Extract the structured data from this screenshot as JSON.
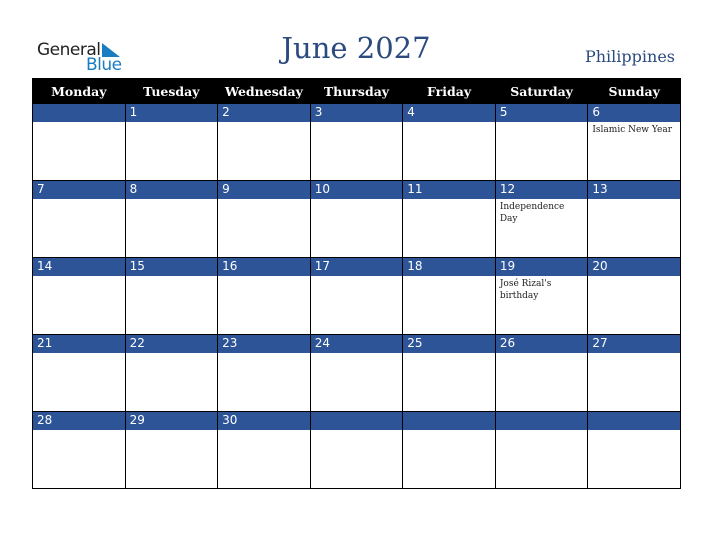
{
  "header": {
    "logo_general": "General",
    "logo_blue": "Blue",
    "title": "June 2027",
    "country": "Philippines"
  },
  "weekdays": [
    "Monday",
    "Tuesday",
    "Wednesday",
    "Thursday",
    "Friday",
    "Saturday",
    "Sunday"
  ],
  "weeks": [
    {
      "days": [
        "",
        "1",
        "2",
        "3",
        "4",
        "5",
        "6"
      ],
      "events": [
        "",
        "",
        "",
        "",
        "",
        "",
        "Islamic New Year"
      ]
    },
    {
      "days": [
        "7",
        "8",
        "9",
        "10",
        "11",
        "12",
        "13"
      ],
      "events": [
        "",
        "",
        "",
        "",
        "",
        "Independence Day",
        ""
      ]
    },
    {
      "days": [
        "14",
        "15",
        "16",
        "17",
        "18",
        "19",
        "20"
      ],
      "events": [
        "",
        "",
        "",
        "",
        "",
        "José Rizal's birthday",
        ""
      ]
    },
    {
      "days": [
        "21",
        "22",
        "23",
        "24",
        "25",
        "26",
        "27"
      ],
      "events": [
        "",
        "",
        "",
        "",
        "",
        "",
        ""
      ]
    },
    {
      "days": [
        "28",
        "29",
        "30",
        "",
        "",
        "",
        ""
      ],
      "events": [
        "",
        "",
        "",
        "",
        "",
        "",
        ""
      ]
    }
  ],
  "colors": {
    "accent": "#2d5496",
    "title": "#2b4a7e",
    "logo_blue": "#1a7cc1"
  }
}
